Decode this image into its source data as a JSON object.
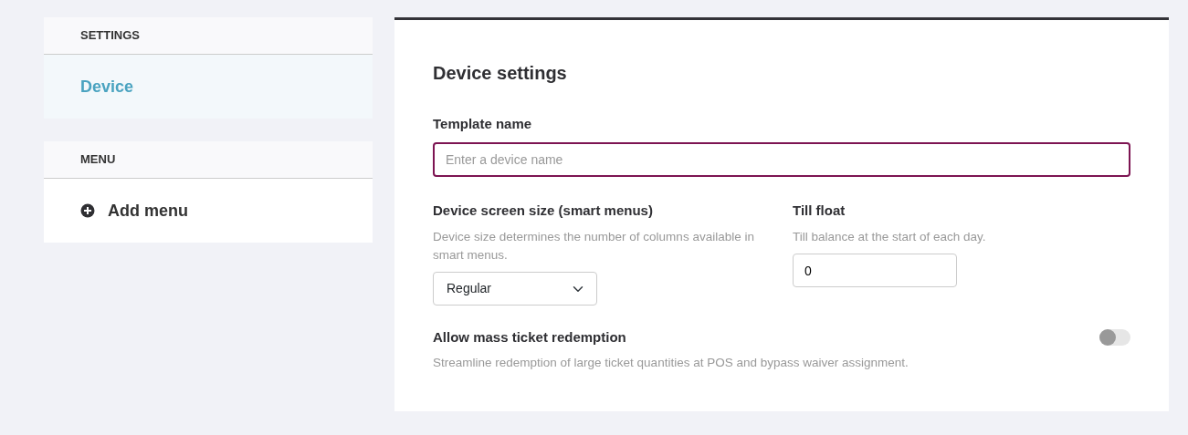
{
  "sidebar": {
    "sections": [
      {
        "header": "SETTINGS",
        "items": [
          {
            "label": "Device",
            "kind": "link",
            "selected": true
          }
        ]
      },
      {
        "header": "MENU",
        "items": [
          {
            "label": "Add menu",
            "kind": "add",
            "selected": false
          }
        ]
      }
    ]
  },
  "panel": {
    "title": "Device settings",
    "template_name": {
      "label": "Template name",
      "placeholder": "Enter a device name"
    },
    "screen_size": {
      "label": "Device screen size (smart menus)",
      "help": "Device size determines the number of columns available in smart menus.",
      "value": "Regular"
    },
    "till_float": {
      "label": "Till float",
      "help": "Till balance at the start of each day.",
      "value": "0"
    },
    "mass_redemption": {
      "label": "Allow mass ticket redemption",
      "help": "Streamline redemption of large ticket quantities at POS and bypass waiver assignment.",
      "on": false
    }
  }
}
